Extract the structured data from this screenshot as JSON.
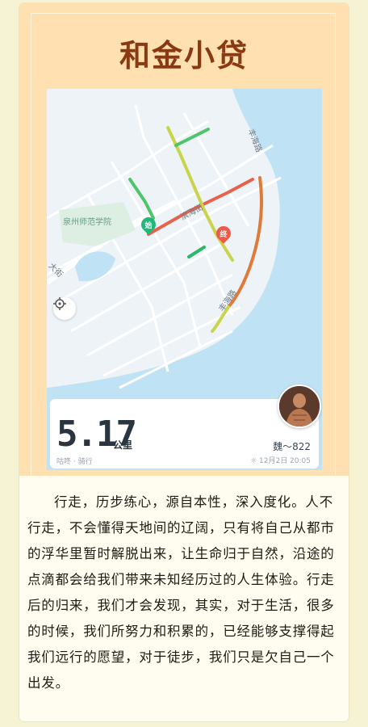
{
  "header": {
    "title": "和金小贷"
  },
  "map": {
    "poi_label": "泉州师范学院",
    "road_labels": [
      "丰海路",
      "滨海街",
      "丰海路",
      "大街"
    ],
    "start_marker": "始",
    "end_marker": "终",
    "locate_icon": "crosshair-icon"
  },
  "stats": {
    "distance": "5.17",
    "unit": "公里",
    "brand": "咕咚 · 骑行",
    "username": "魏～822",
    "datetime": "12月2日 20:05"
  },
  "article": {
    "text": "行走，历步练心，源自本性，深入度化。人不行走，不会懂得天地间的辽阔，只有将自己从都市的浮华里暂时解脱出来，让生命归于自然，沿途的点滴都会给我们带来未知经历过的人生体验。行走后的归来，我们才会发现，其实，对于生活，很多的时候，我们所努力和积累的，已经能够支撑得起我们远行的愿望，对于徒步，我们只是欠自己一个出发。"
  },
  "colors": {
    "accent": "#8a3a12",
    "header_bg": "#ffe0b0",
    "page_bg": "#f5f3d4",
    "sea": "#bfe3f4",
    "route_red": "#e8614a",
    "route_green": "#4fc46a",
    "route_yellow": "#c9d44a"
  }
}
